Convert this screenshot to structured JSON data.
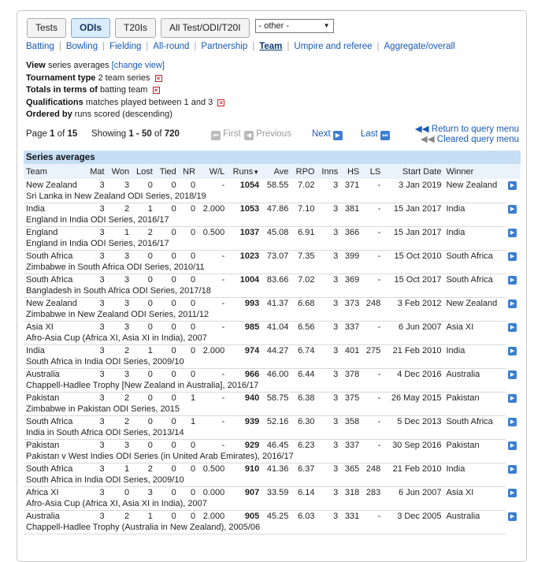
{
  "format_tabs": [
    "Tests",
    "ODIs",
    "T20Is",
    "All Test/ODI/T20I"
  ],
  "active_format": "ODIs",
  "other_select": "- other -",
  "subnav": [
    {
      "label": "Batting"
    },
    {
      "label": "Bowling"
    },
    {
      "label": "Fielding"
    },
    {
      "label": "All-round"
    },
    {
      "label": "Partnership"
    },
    {
      "label": "Team",
      "current": true
    },
    {
      "label": "Umpire and referee"
    },
    {
      "label": "Aggregate/overall"
    }
  ],
  "query": {
    "view_label": "View",
    "view_value": "series averages",
    "change_view": "[change view]",
    "tournament_label": "Tournament type",
    "tournament_value": "2 team series",
    "totals_label": "Totals in terms of",
    "totals_value": "batting team",
    "qual_label": "Qualifications",
    "qual_value": "matches played between 1 and 3",
    "ordered_label": "Ordered by",
    "ordered_value": "runs scored (descending)"
  },
  "pager": {
    "page_prefix": "Page",
    "page": "1",
    "page_of": "of",
    "pages": "15",
    "showing_prefix": "Showing",
    "range": "1 - 50",
    "range_of": "of",
    "total": "720",
    "first": "First",
    "previous": "Previous",
    "next": "Next",
    "last": "Last",
    "return_query": "Return to query menu",
    "cleared_query": "Cleared query menu"
  },
  "table": {
    "caption": "Series averages",
    "headers": [
      "Team",
      "Mat",
      "Won",
      "Lost",
      "Tied",
      "NR",
      "W/L",
      "Runs",
      "Ave",
      "RPO",
      "Inns",
      "HS",
      "LS",
      "Start Date",
      "Winner"
    ],
    "rows": [
      {
        "team": "New Zealand",
        "mat": "3",
        "won": "3",
        "lost": "0",
        "tied": "0",
        "nr": "0",
        "wl": "-",
        "runs": "1054",
        "ave": "58.55",
        "rpo": "7.02",
        "inns": "3",
        "hs": "371",
        "ls": "-",
        "date": "3 Jan 2019",
        "winner": "New Zealand",
        "series": "Sri Lanka in New Zealand ODI Series, 2018/19"
      },
      {
        "team": "India",
        "mat": "3",
        "won": "2",
        "lost": "1",
        "tied": "0",
        "nr": "0",
        "wl": "2.000",
        "runs": "1053",
        "ave": "47.86",
        "rpo": "7.10",
        "inns": "3",
        "hs": "381",
        "ls": "-",
        "date": "15 Jan 2017",
        "winner": "India",
        "series": "England in India ODI Series, 2016/17"
      },
      {
        "team": "England",
        "mat": "3",
        "won": "1",
        "lost": "2",
        "tied": "0",
        "nr": "0",
        "wl": "0.500",
        "runs": "1037",
        "ave": "45.08",
        "rpo": "6.91",
        "inns": "3",
        "hs": "366",
        "ls": "-",
        "date": "15 Jan 2017",
        "winner": "India",
        "series": "England in India ODI Series, 2016/17"
      },
      {
        "team": "South Africa",
        "mat": "3",
        "won": "3",
        "lost": "0",
        "tied": "0",
        "nr": "0",
        "wl": "-",
        "runs": "1023",
        "ave": "73.07",
        "rpo": "7.35",
        "inns": "3",
        "hs": "399",
        "ls": "-",
        "date": "15 Oct 2010",
        "winner": "South Africa",
        "series": "Zimbabwe in South Africa ODI Series, 2010/11"
      },
      {
        "team": "South Africa",
        "mat": "3",
        "won": "3",
        "lost": "0",
        "tied": "0",
        "nr": "0",
        "wl": "-",
        "runs": "1004",
        "ave": "83.66",
        "rpo": "7.02",
        "inns": "3",
        "hs": "369",
        "ls": "-",
        "date": "15 Oct 2017",
        "winner": "South Africa",
        "series": "Bangladesh in South Africa ODI Series, 2017/18"
      },
      {
        "team": "New Zealand",
        "mat": "3",
        "won": "3",
        "lost": "0",
        "tied": "0",
        "nr": "0",
        "wl": "-",
        "runs": "993",
        "ave": "41.37",
        "rpo": "6.68",
        "inns": "3",
        "hs": "373",
        "ls": "248",
        "date": "3 Feb 2012",
        "winner": "New Zealand",
        "series": "Zimbabwe in New Zealand ODI Series, 2011/12"
      },
      {
        "team": "Asia XI",
        "mat": "3",
        "won": "3",
        "lost": "0",
        "tied": "0",
        "nr": "0",
        "wl": "-",
        "runs": "985",
        "ave": "41.04",
        "rpo": "6.56",
        "inns": "3",
        "hs": "337",
        "ls": "-",
        "date": "6 Jun 2007",
        "winner": "Asia XI",
        "series": "Afro-Asia Cup (Africa XI, Asia XI in India), 2007"
      },
      {
        "team": "India",
        "mat": "3",
        "won": "2",
        "lost": "1",
        "tied": "0",
        "nr": "0",
        "wl": "2.000",
        "runs": "974",
        "ave": "44.27",
        "rpo": "6.74",
        "inns": "3",
        "hs": "401",
        "ls": "275",
        "date": "21 Feb 2010",
        "winner": "India",
        "series": "South Africa in India ODI Series, 2009/10"
      },
      {
        "team": "Australia",
        "mat": "3",
        "won": "3",
        "lost": "0",
        "tied": "0",
        "nr": "0",
        "wl": "-",
        "runs": "966",
        "ave": "46.00",
        "rpo": "6.44",
        "inns": "3",
        "hs": "378",
        "ls": "-",
        "date": "4 Dec 2016",
        "winner": "Australia",
        "series": "Chappell-Hadlee Trophy [New Zealand in Australia], 2016/17"
      },
      {
        "team": "Pakistan",
        "mat": "3",
        "won": "2",
        "lost": "0",
        "tied": "0",
        "nr": "1",
        "wl": "-",
        "runs": "940",
        "ave": "58.75",
        "rpo": "6.38",
        "inns": "3",
        "hs": "375",
        "ls": "-",
        "date": "26 May 2015",
        "winner": "Pakistan",
        "series": "Zimbabwe in Pakistan ODI Series, 2015"
      },
      {
        "team": "South Africa",
        "mat": "3",
        "won": "2",
        "lost": "0",
        "tied": "0",
        "nr": "1",
        "wl": "-",
        "runs": "939",
        "ave": "52.16",
        "rpo": "6.30",
        "inns": "3",
        "hs": "358",
        "ls": "-",
        "date": "5 Dec 2013",
        "winner": "South Africa",
        "series": "India in South Africa ODI Series, 2013/14"
      },
      {
        "team": "Pakistan",
        "mat": "3",
        "won": "3",
        "lost": "0",
        "tied": "0",
        "nr": "0",
        "wl": "-",
        "runs": "929",
        "ave": "46.45",
        "rpo": "6.23",
        "inns": "3",
        "hs": "337",
        "ls": "-",
        "date": "30 Sep 2016",
        "winner": "Pakistan",
        "series": "Pakistan v West Indies ODI Series (in United Arab Emirates), 2016/17"
      },
      {
        "team": "South Africa",
        "mat": "3",
        "won": "1",
        "lost": "2",
        "tied": "0",
        "nr": "0",
        "wl": "0.500",
        "runs": "910",
        "ave": "41.36",
        "rpo": "6.37",
        "inns": "3",
        "hs": "365",
        "ls": "248",
        "date": "21 Feb 2010",
        "winner": "India",
        "series": "South Africa in India ODI Series, 2009/10"
      },
      {
        "team": "Africa XI",
        "mat": "3",
        "won": "0",
        "lost": "3",
        "tied": "0",
        "nr": "0",
        "wl": "0.000",
        "runs": "907",
        "ave": "33.59",
        "rpo": "6.14",
        "inns": "3",
        "hs": "318",
        "ls": "283",
        "date": "6 Jun 2007",
        "winner": "Asia XI",
        "series": "Afro-Asia Cup (Africa XI, Asia XI in India), 2007"
      },
      {
        "team": "Australia",
        "mat": "3",
        "won": "2",
        "lost": "1",
        "tied": "0",
        "nr": "0",
        "wl": "2.000",
        "runs": "905",
        "ave": "45.25",
        "rpo": "6.03",
        "inns": "3",
        "hs": "331",
        "ls": "-",
        "date": "3 Dec 2005",
        "winner": "Australia",
        "series": "Chappell-Hadlee Trophy (Australia in New Zealand), 2005/06"
      }
    ]
  }
}
